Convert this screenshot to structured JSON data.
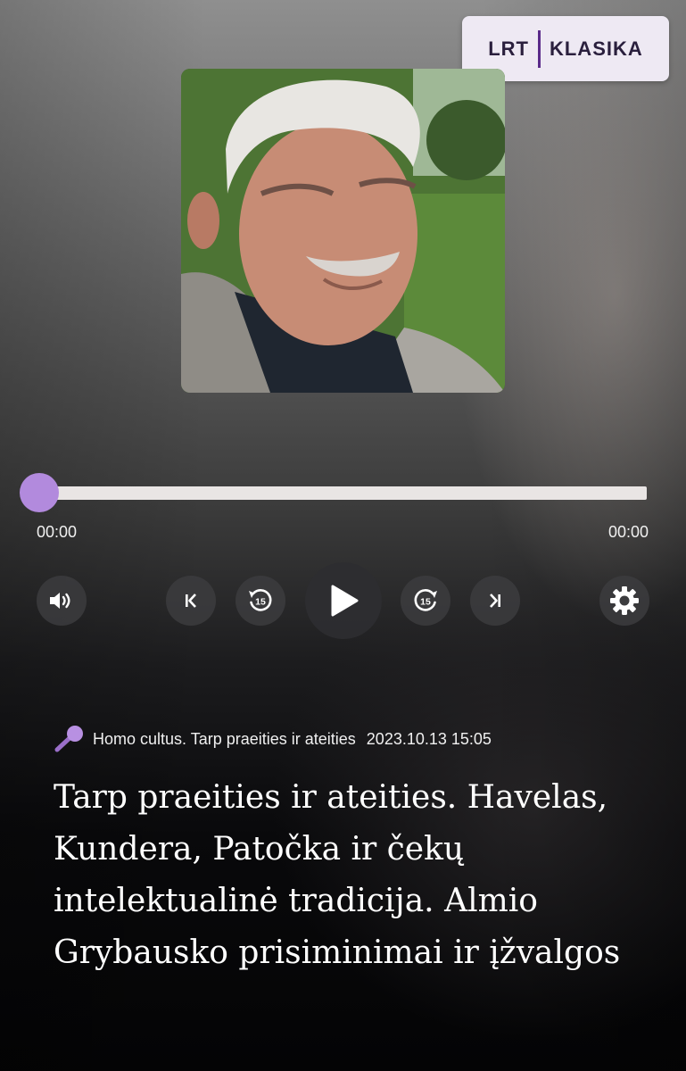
{
  "logo": {
    "left": "LRT",
    "right": "KLASIKA"
  },
  "player": {
    "progress": 0,
    "time_start": "00:00",
    "time_end": "00:00",
    "rewind_seconds": "15",
    "forward_seconds": "15"
  },
  "icons": {
    "volume": "volume-icon",
    "previous": "skip-previous-icon",
    "rewind": "rewind-15-icon",
    "play": "play-icon",
    "forward": "forward-15-icon",
    "next": "skip-next-icon",
    "settings": "gear-icon",
    "microphone": "microphone-icon"
  },
  "episode": {
    "show": "Homo cultus. Tarp praeities ir ateities",
    "date": "2023.10.13 15:05",
    "title": "Tarp praeities ir ateities. Havelas, Kundera, Patočka ir čekų intelektualinė tradicija. Almio Grybausko prisiminimai ir įžvalgos"
  },
  "colors": {
    "accent": "#b28add",
    "track": "#e9e5e4",
    "logo_bg": "#eee9f3"
  }
}
